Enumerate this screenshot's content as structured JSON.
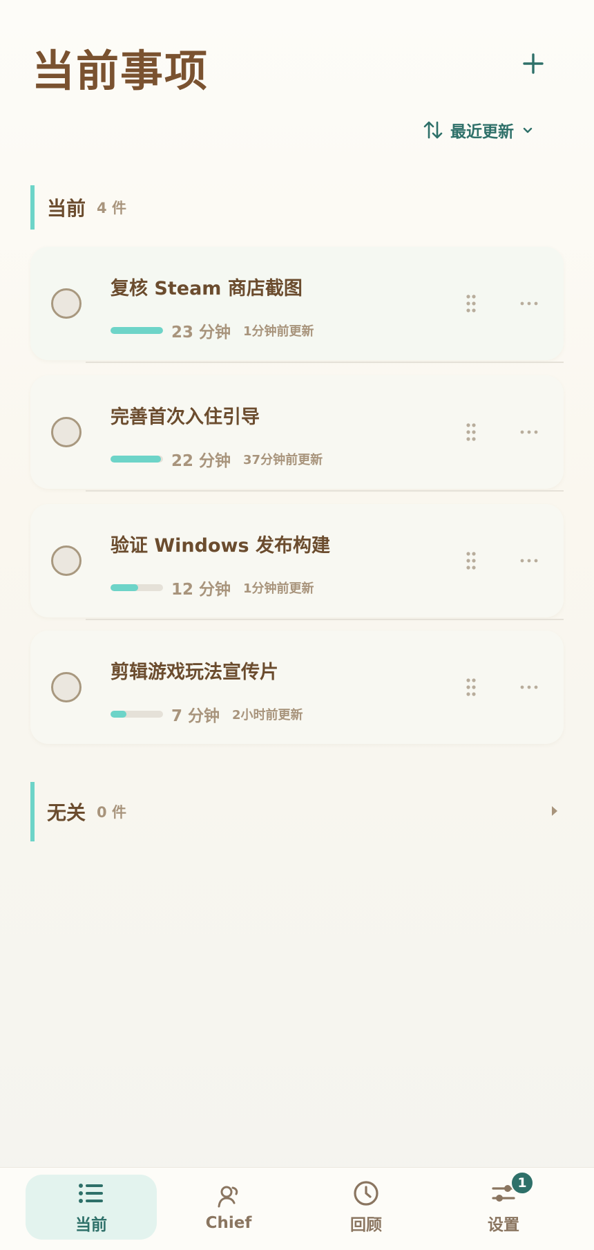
{
  "header": {
    "title": "当前事项",
    "sort_label": "最近更新"
  },
  "sections": [
    {
      "title": "当前",
      "count": "4 件"
    },
    {
      "title": "无关",
      "count": "0 件"
    }
  ],
  "tasks": [
    {
      "title": "复核 Steam 商店截图",
      "duration": "23 分钟",
      "updated": "1分钟前更新",
      "progress": 1.0
    },
    {
      "title": "完善首次入住引导",
      "duration": "22 分钟",
      "updated": "37分钟前更新",
      "progress": 0.96
    },
    {
      "title": "验证 Windows 发布构建",
      "duration": "12 分钟",
      "updated": "1分钟前更新",
      "progress": 0.52
    },
    {
      "title": "剪辑游戏玩法宣传片",
      "duration": "7 分钟",
      "updated": "2小时前更新",
      "progress": 0.3
    }
  ],
  "tabbar": {
    "tabs": [
      {
        "label": "当前",
        "icon": "list-icon"
      },
      {
        "label": "Chief",
        "icon": "chief-icon"
      },
      {
        "label": "回顾",
        "icon": "clock-icon"
      },
      {
        "label": "设置",
        "icon": "sliders-icon",
        "badge": "1"
      }
    ],
    "active_index": 0
  },
  "colors": {
    "accent": "#2e7069",
    "teal": "#6dd4c8",
    "title_brown": "#7a5230",
    "muted": "#a8947c"
  }
}
